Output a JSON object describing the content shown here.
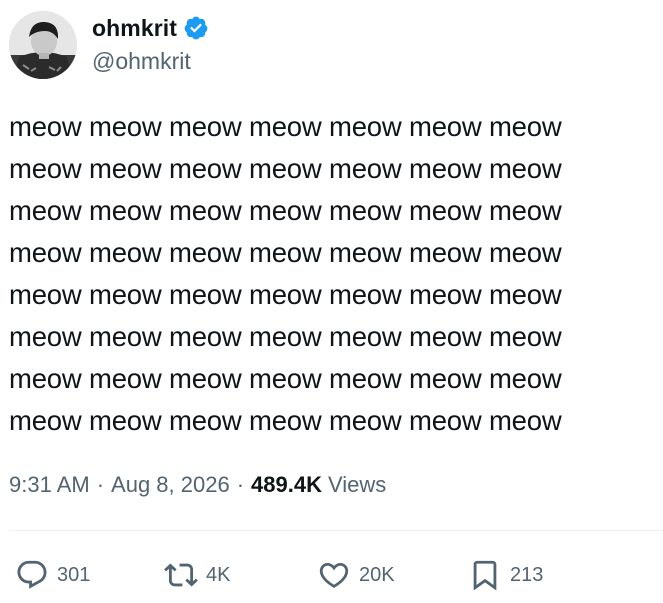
{
  "author": {
    "display_name": "ohmkrit",
    "handle": "@ohmkrit",
    "verified": true,
    "verified_color": "#1d9bf0",
    "avatar_icon": "profile-photo"
  },
  "tweet": {
    "text": "meow meow meow meow meow meow meow\nmeow meow meow meow meow meow meow\nmeow meow meow meow meow meow meow\nmeow meow meow meow meow meow meow\nmeow meow meow meow meow meow meow\nmeow meow meow meow meow meow meow\nmeow meow meow meow meow meow meow\nmeow meow meow meow meow meow meow"
  },
  "meta": {
    "time": "9:31 AM",
    "separator": "·",
    "date": "Aug 8, 2026",
    "views_count": "489.4K",
    "views_label": "Views"
  },
  "actions": {
    "reply": {
      "icon": "reply-icon",
      "count": "301"
    },
    "repost": {
      "icon": "repost-icon",
      "count": "4K"
    },
    "like": {
      "icon": "heart-icon",
      "count": "20K"
    },
    "bookmark": {
      "icon": "bookmark-icon",
      "count": "213"
    }
  },
  "colors": {
    "text_primary": "#0f1419",
    "text_secondary": "#536471",
    "divider": "#eff3f4"
  }
}
